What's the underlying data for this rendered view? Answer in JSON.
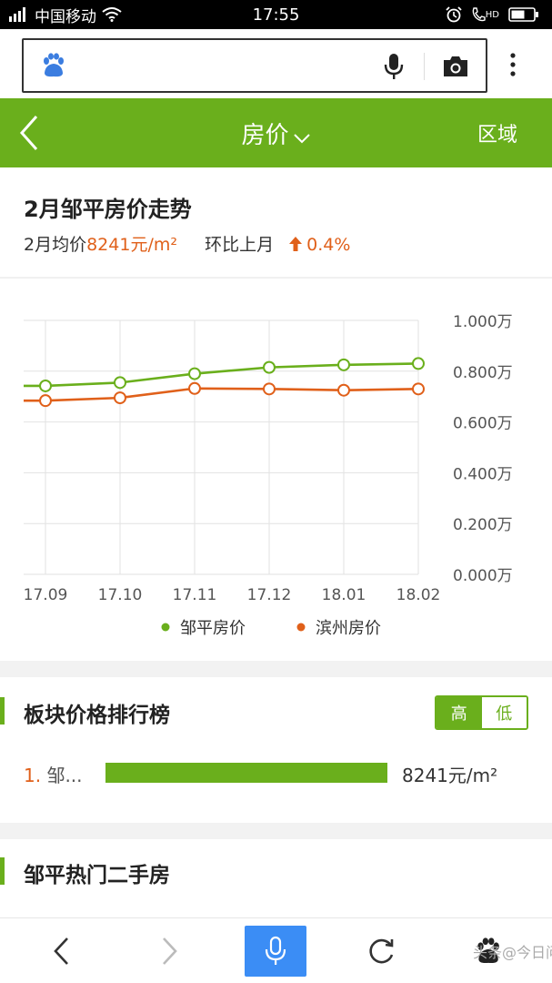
{
  "status_bar": {
    "carrier": "中国移动",
    "time": "17:55",
    "network": "HD"
  },
  "browser": {
    "search_value": ""
  },
  "header": {
    "title": "房价",
    "right_label": "区域"
  },
  "summary": {
    "title": "2月邹平房价走势",
    "avg_label": "2月均价",
    "avg_value": "8241元/m²",
    "mom_label": "环比上月",
    "mom_value": "0.4%"
  },
  "chart_data": {
    "type": "line",
    "categories": [
      "17.09",
      "17.10",
      "17.11",
      "17.12",
      "18.01",
      "18.02"
    ],
    "y_ticks": [
      "1.000万",
      "0.800万",
      "0.600万",
      "0.400万",
      "0.200万",
      "0.000万"
    ],
    "ylim": [
      0,
      1.0
    ],
    "grid": true,
    "legend_position": "bottom",
    "series": [
      {
        "name": "邹平房价",
        "color": "#6aaf1c",
        "values": [
          0.742,
          0.755,
          0.79,
          0.815,
          0.825,
          0.83
        ]
      },
      {
        "name": "滨州房价",
        "color": "#e0601a",
        "values": [
          0.684,
          0.695,
          0.732,
          0.73,
          0.725,
          0.73
        ]
      }
    ]
  },
  "ranking": {
    "title": "板块价格排行榜",
    "toggle_high": "高",
    "toggle_low": "低",
    "items": [
      {
        "rank": "1.",
        "name": "邹...",
        "value": "8241元/m²",
        "fraction": 1.0
      }
    ]
  },
  "hot": {
    "title": "邹平热门二手房"
  },
  "watermark": "头条@今日问答",
  "colors": {
    "brand_green": "#6aaf1c",
    "accent_orange": "#e0601a",
    "mic_blue": "#3b8df5"
  }
}
